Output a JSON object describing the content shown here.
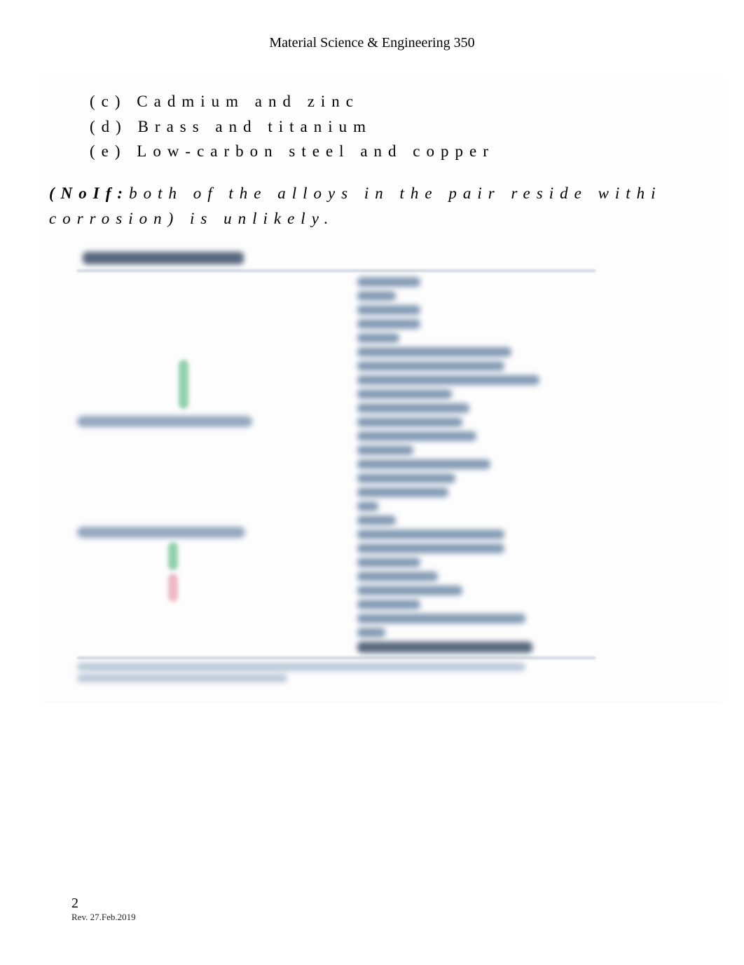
{
  "header": {
    "title": "Material Science & Engineering 350"
  },
  "options": {
    "c": "(c) Cadmium and zinc",
    "d": "(d) Brass and titanium",
    "e": "(e) Low-carbon steel and copper"
  },
  "note": {
    "line1_bold": "(No",
    "line1_bold2": "If:",
    "line1_plain": "both of the alloys in the pair reside withi",
    "line2_plain_a": "corrosion",
    "line2_plain_b": ") is unlikely."
  },
  "footer": {
    "page_number": "2",
    "revision": "Rev. 27.Feb.2019"
  }
}
